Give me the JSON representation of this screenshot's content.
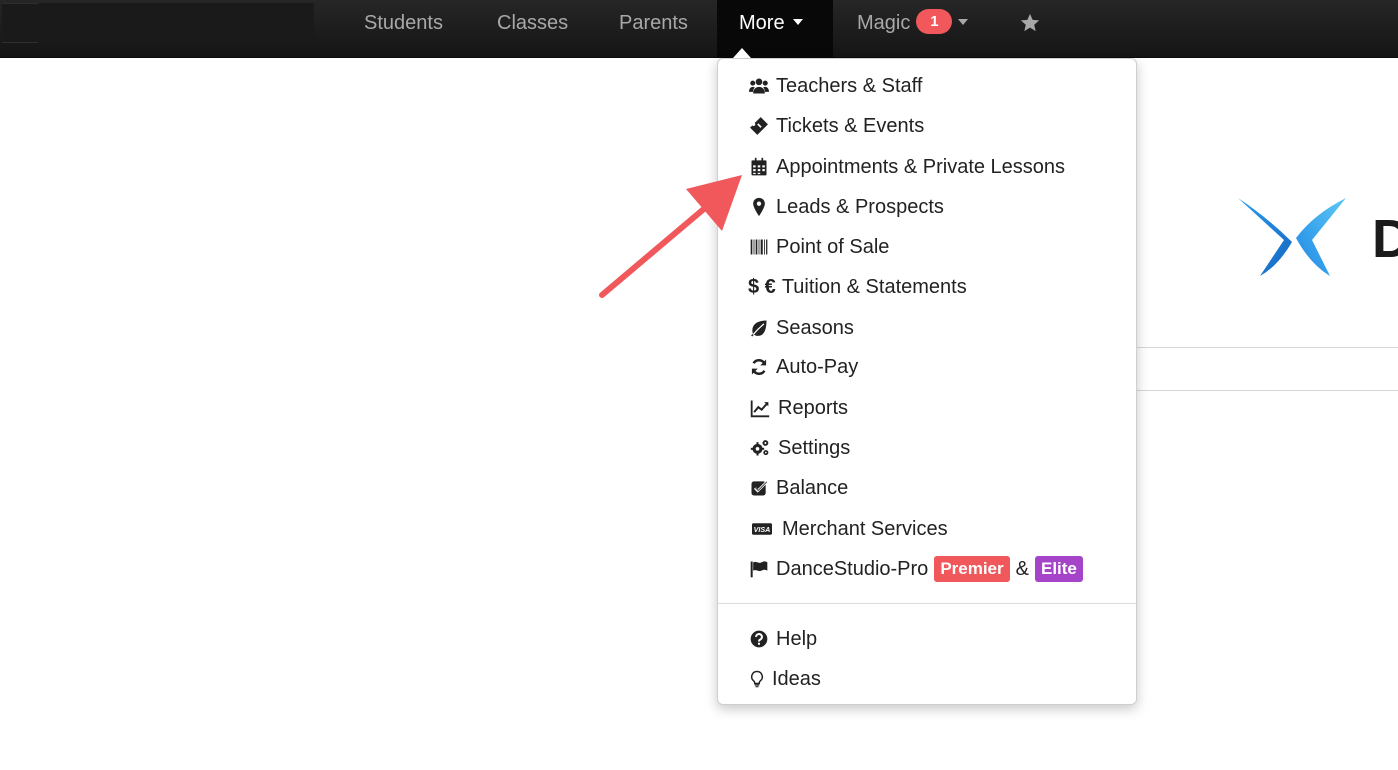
{
  "navbar": {
    "items": [
      {
        "label": "Students"
      },
      {
        "label": "Classes"
      },
      {
        "label": "Parents"
      },
      {
        "label": "More"
      },
      {
        "label": "Magic",
        "badge": "1"
      }
    ],
    "icons": [
      "caret-down-icon",
      "star-icon"
    ]
  },
  "dropdown": {
    "items": [
      {
        "label": "Teachers & Staff",
        "icon": "users-icon"
      },
      {
        "label": "Tickets & Events",
        "icon": "ticket-icon"
      },
      {
        "label": "Appointments & Private Lessons",
        "icon": "calendar-icon"
      },
      {
        "label": "Leads & Prospects",
        "icon": "map-marker-icon"
      },
      {
        "label": "Point of Sale",
        "icon": "barcode-icon"
      },
      {
        "label": "Tuition & Statements",
        "symbols": "$ €"
      },
      {
        "label": "Seasons",
        "icon": "leaf-icon"
      },
      {
        "label": "Auto-Pay",
        "icon": "refresh-icon"
      },
      {
        "label": "Reports",
        "icon": "line-chart-icon"
      },
      {
        "label": "Settings",
        "icon": "cogs-icon"
      },
      {
        "label": "Balance",
        "icon": "check-square-icon"
      },
      {
        "label": "Merchant Services",
        "icon": "visa-card-icon",
        "card_text": "VISA"
      },
      {
        "label": "DanceStudio-Pro",
        "icon": "flag-icon",
        "tags": [
          {
            "text": "Premier",
            "color": "#f0585b"
          },
          {
            "text": "&"
          },
          {
            "text": "Elite",
            "color": "#a543c9"
          }
        ]
      },
      {
        "label": "Help",
        "icon": "question-circle-icon"
      },
      {
        "label": "Ideas",
        "icon": "lightbulb-icon"
      }
    ]
  },
  "background": {
    "logo_letter": "D"
  },
  "colors": {
    "navbar_bg": "#1c1c1c",
    "badge": "#f0585b",
    "premier": "#f0585b",
    "elite": "#a543c9",
    "arrow": "#f0585b",
    "logo_blue": "#1e88e5"
  }
}
